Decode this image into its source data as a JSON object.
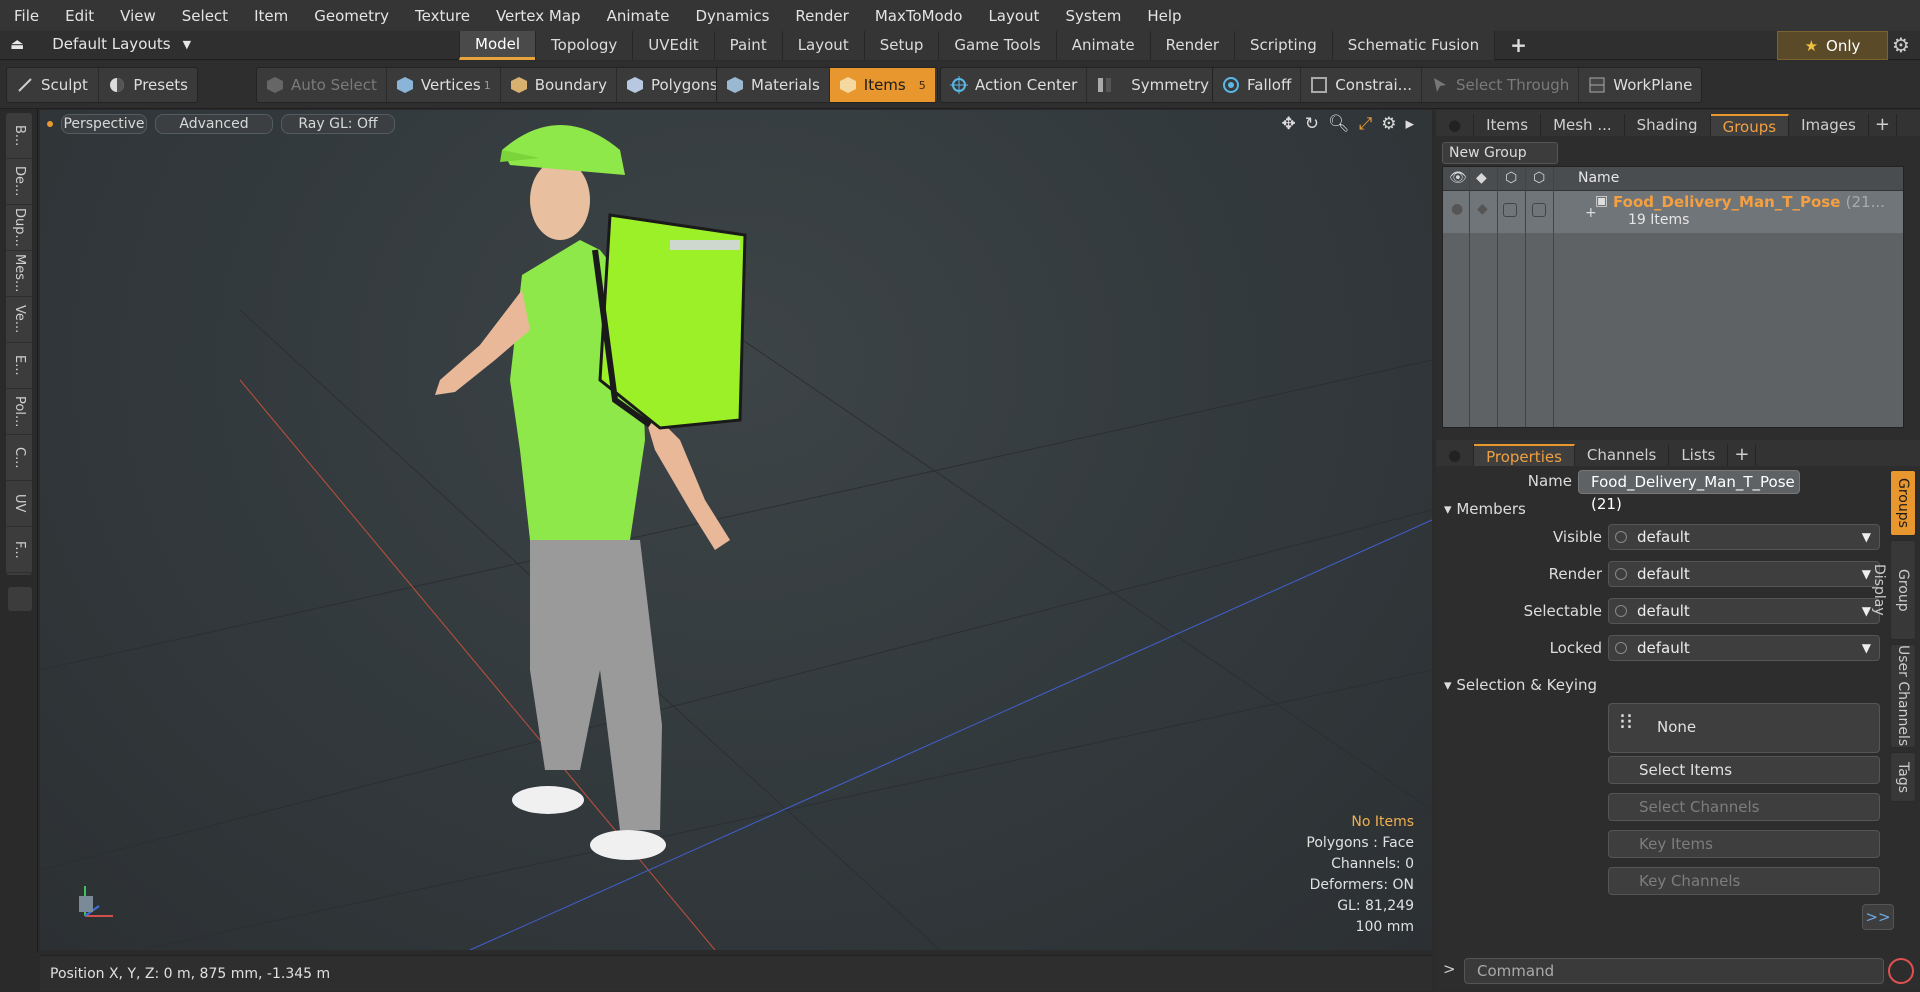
{
  "menu": [
    "File",
    "Edit",
    "View",
    "Select",
    "Item",
    "Geometry",
    "Texture",
    "Vertex Map",
    "Animate",
    "Dynamics",
    "Render",
    "MaxToModo",
    "Layout",
    "System",
    "Help"
  ],
  "layouts_label": "Default Layouts",
  "tabs": [
    "Model",
    "Topology",
    "UVEdit",
    "Paint",
    "Layout",
    "Setup",
    "Game Tools",
    "Animate",
    "Render",
    "Scripting",
    "Schematic Fusion"
  ],
  "active_tab": "Model",
  "only_label": "Only",
  "toolbar": {
    "sculpt": "Sculpt",
    "presets": "Presets",
    "auto_select": "Auto Select",
    "vertices": "Vertices",
    "vertices_count": "1",
    "boundary": "Boundary",
    "polygons": "Polygons",
    "materials": "Materials",
    "items": "Items",
    "items_count": "5",
    "action_center": "Action Center",
    "symmetry": "Symmetry",
    "falloff": "Falloff",
    "constraints": "Constrai...",
    "select_through": "Select Through",
    "workplane": "WorkPlane"
  },
  "left_tabs": [
    "B...",
    "De...",
    "Dup...",
    "Mes...",
    "Ve...",
    "E...",
    "Pol...",
    "C...",
    "UV",
    "F..."
  ],
  "viewport": {
    "perspective": "Perspective",
    "advanced": "Advanced",
    "raygl": "Ray GL: Off",
    "stats": {
      "no_items": "No Items",
      "polygons": "Polygons : Face",
      "channels": "Channels: 0",
      "deformers": "Deformers: ON",
      "gl": "GL: 81,249",
      "scale": "100 mm"
    }
  },
  "status": "Position X, Y, Z:   0 m, 875 mm, -1.345 m",
  "groups_panel": {
    "tabs": [
      "Items",
      "Mesh ...",
      "Shading",
      "Groups",
      "Images"
    ],
    "active": "Groups",
    "new_group": "New Group",
    "col_name": "Name",
    "group_name": "Food_Delivery_Man_T_Pose",
    "group_count": "(21...",
    "group_items": "19 Items"
  },
  "properties_panel": {
    "tabs": [
      "Properties",
      "Channels",
      "Lists"
    ],
    "active": "Properties",
    "name_label": "Name",
    "name_value": "Food_Delivery_Man_T_Pose (21)",
    "members": "Members",
    "visible_label": "Visible",
    "render_label": "Render",
    "selectable_label": "Selectable",
    "locked_label": "Locked",
    "default_value": "default",
    "sel_keying": "Selection & Keying",
    "none": "None",
    "select_items": "Select Items",
    "select_channels": "Select Channels",
    "key_items": "Key Items",
    "key_channels": "Key Channels",
    "ff": ">>"
  },
  "right_vtabs": [
    "Groups",
    "Group Display",
    "User Channels",
    "Tags"
  ],
  "command_placeholder": "Command",
  "colors": {
    "accent": "#e8962e",
    "shirt": "#8ee84a",
    "bag": "#9cf028"
  }
}
